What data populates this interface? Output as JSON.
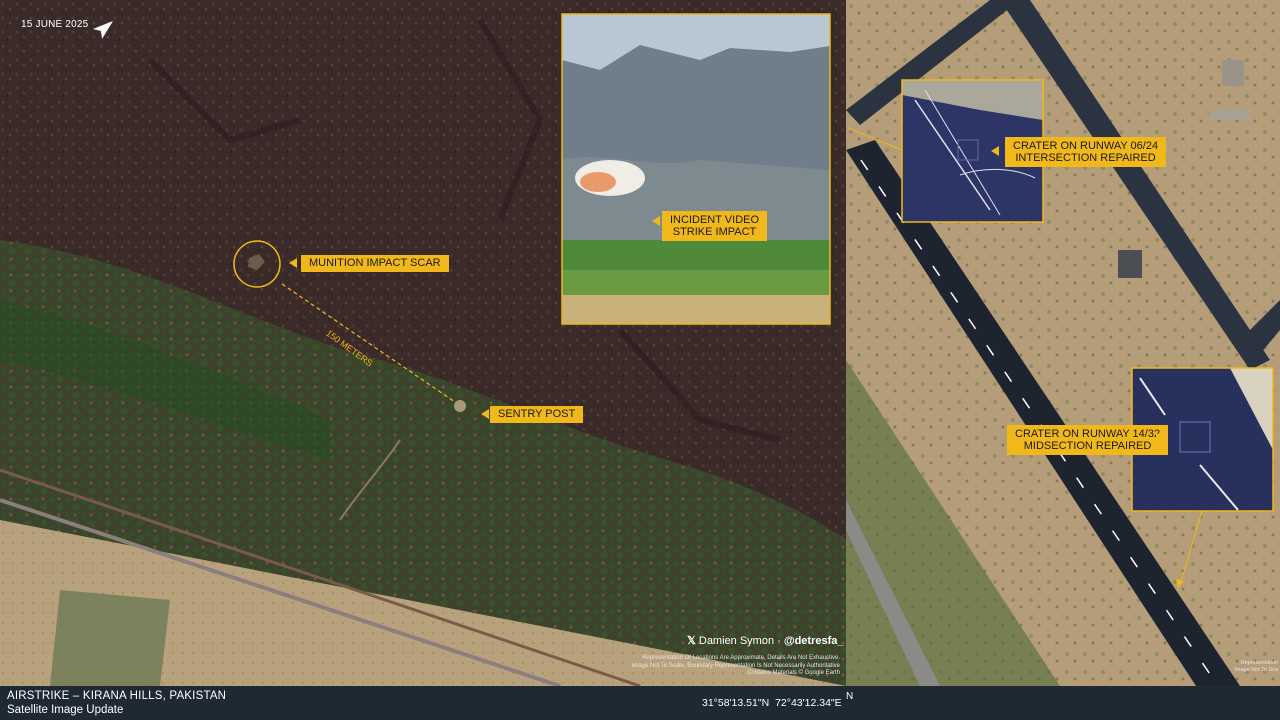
{
  "date": "15 JUNE 2025",
  "labels": {
    "munition_impact": "MUNITION IMPACT SCAR",
    "sentry_post": "SENTRY POST",
    "distance": "150 METERS",
    "incident_video_line1": "INCIDENT VIDEO",
    "incident_video_line2": "STRIKE IMPACT",
    "crater_0624_line1": "CRATER ON RUNWAY 06/24",
    "crater_0624_line2": "INTERSECTION REPAIRED",
    "crater_1432_line1": "CRATER ON RUNWAY 14/32",
    "crater_1432_line2": "MIDSECTION REPAIRED"
  },
  "credit": {
    "name": "Damien Symon · ",
    "handle": "@detresfa_"
  },
  "disclaimer": {
    "line1": "Representation Of Locations Are Approximate, Details Are Not Exhaustive.",
    "line2": "Image Not To Scale, Boundary Representation Is Not Necessarily Authoritative",
    "line3": "Contains Materials © Google Earth"
  },
  "disclaimer_right": {
    "line1": "Representation",
    "line2": "Image Not To Sca"
  },
  "footer": {
    "title": "AIRSTRIKE – KIRANA HILLS, PAKISTAN",
    "subtitle": "Satellite Image Update",
    "coords": "31°58'13.51\"N  72°43'12.34\"E",
    "north": "N"
  },
  "colors": {
    "accent": "#f0b81a",
    "footer_bg": "#1f2933"
  }
}
